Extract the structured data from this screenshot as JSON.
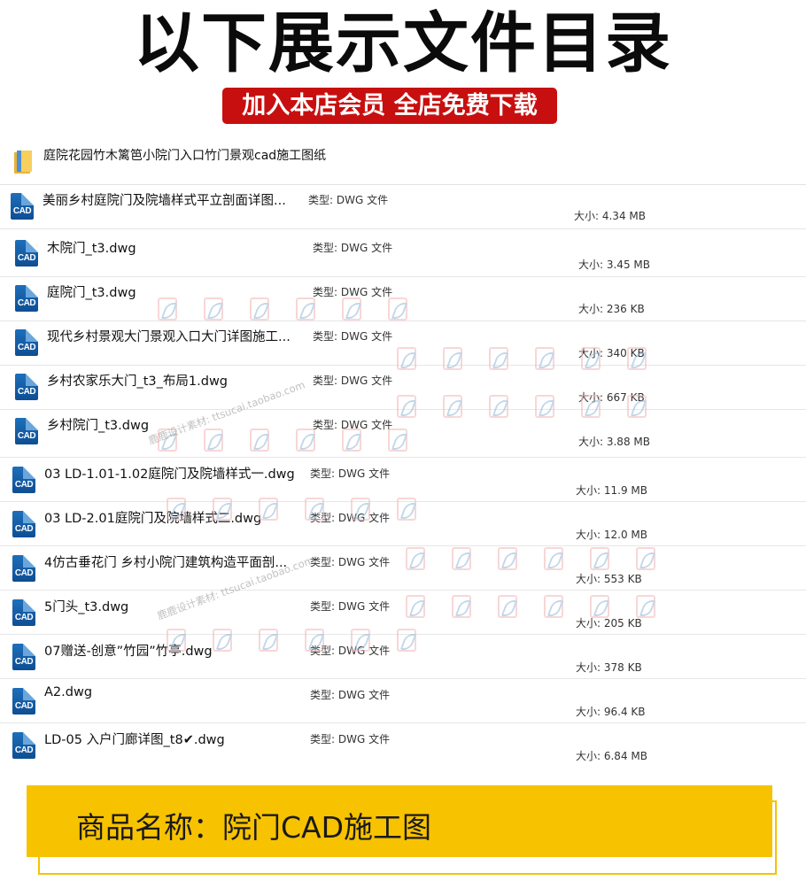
{
  "header": {
    "title": "以下展示文件目录",
    "promo": "加入本店会员 全店免费下载"
  },
  "folder": {
    "name": "庭院花园竹木篱笆小院门入口竹门景观cad施工图纸"
  },
  "files": [
    {
      "name": "美丽乡村庭院门及院墙样式平立剖面详图...",
      "type": "类型: DWG 文件",
      "size": "大小: 4.34 MB"
    },
    {
      "name": "木院门_t3.dwg",
      "type": "类型: DWG 文件",
      "size": "大小: 3.45 MB"
    },
    {
      "name": "庭院门_t3.dwg",
      "type": "类型: DWG 文件",
      "size": "大小: 236 KB"
    },
    {
      "name": "现代乡村景观大门景观入口大门详图施工...",
      "type": "类型: DWG 文件",
      "size": "大小: 340 KB"
    },
    {
      "name": "乡村农家乐大门_t3_布局1.dwg",
      "type": "类型: DWG 文件",
      "size": "大小: 667 KB"
    },
    {
      "name": "乡村院门_t3.dwg",
      "type": "类型: DWG 文件",
      "size": "大小: 3.88 MB"
    },
    {
      "name": "03 LD-1.01-1.02庭院门及院墙样式一.dwg",
      "type": "类型: DWG 文件",
      "size": "大小: 11.9 MB"
    },
    {
      "name": "03 LD-2.01庭院门及院墙样式二.dwg",
      "type": "类型: DWG 文件",
      "size": "大小: 12.0 MB"
    },
    {
      "name": "4仿古垂花门 乡村小院门建筑构造平面剖...",
      "type": "类型: DWG 文件",
      "size": "大小: 553 KB"
    },
    {
      "name": "5门头_t3.dwg",
      "type": "类型: DWG 文件",
      "size": "大小: 205 KB"
    },
    {
      "name": "07赠送-创意”竹园”竹亭.dwg",
      "type": "类型: DWG 文件",
      "size": "大小: 378 KB"
    },
    {
      "name": "A2.dwg",
      "type": "类型: DWG 文件",
      "size": "大小: 96.4 KB"
    },
    {
      "name": "LD-05 入户门廊详图_t8✔.dwg",
      "type": "类型: DWG 文件",
      "size": "大小: 6.84 MB"
    }
  ],
  "icons": {
    "folder": "folder-icon",
    "file": "cad-file-icon",
    "watermark": "watermark-logo-icon"
  },
  "watermark": {
    "text": "鹿鹿设计素材: ttsucai.taobao.com"
  },
  "product": {
    "label": "商品名称：院门CAD施工图"
  },
  "colors": {
    "promo_bg": "#c80f0f",
    "product_bg": "#f7c200",
    "cad_icon": "#1d6fba"
  }
}
